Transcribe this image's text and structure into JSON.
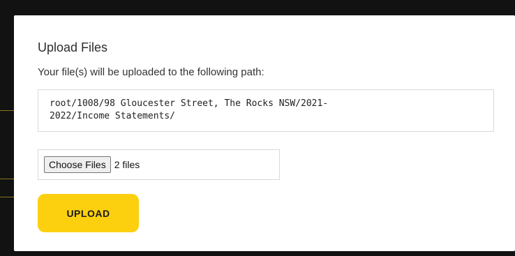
{
  "modal": {
    "title": "Upload Files",
    "path_label": "Your file(s) will be uploaded to the following path:",
    "path_value": "root/1008/98 Gloucester Street, The Rocks NSW/2021-\n2022/Income Statements/"
  },
  "file_input": {
    "button_label": "Choose Files",
    "selected_text": "2 files"
  },
  "upload_button": {
    "label": "UPLOAD"
  },
  "colors": {
    "accent": "#fcd00f",
    "backdrop": "#121212"
  }
}
